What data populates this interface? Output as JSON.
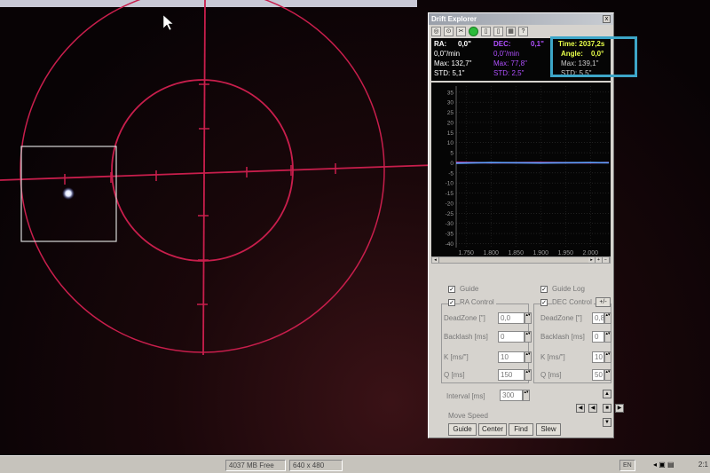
{
  "background_window": {
    "title": ""
  },
  "drift_explorer": {
    "title": "Drift Explorer",
    "close": "x",
    "toolbar_icons": [
      "target-icon",
      "target2-icon",
      "tools-icon",
      "record-icon",
      "page-icon",
      "page2-icon",
      "map-icon",
      "help-icon"
    ],
    "stats": {
      "ra_label": "RA:",
      "ra_value": "0,0\"",
      "ra_rate": "0,0\"/min",
      "ra_max": "Max: 132,7\"",
      "ra_std": "STD: 5,1\"",
      "dec_label": "DEC:",
      "dec_value": "0,1\"",
      "dec_rate": "0,0\"/min",
      "dec_max": "Max: 77,8\"",
      "dec_std": "STD: 2,5\"",
      "time": "Time: 2037,2s",
      "angle_label": "Angle:",
      "angle_value": "0,0°",
      "angle_max": "Max: 139,1\"",
      "angle_std": "STD: 5,5\""
    },
    "controls": {
      "guide": "Guide",
      "guide_log": "Guide Log",
      "ra_control": "RA Control",
      "dec_control": "DEC Control",
      "dec_swap": "+/-",
      "deadzone_label": "DeadZone [\"]",
      "backlash_label": "Backlash [ms]",
      "k_label": "K [ms/\"]",
      "q_label": "Q [ms]",
      "ra_deadzone": "0,0",
      "ra_backlash": "0",
      "ra_k": "10",
      "ra_q": "150",
      "dec_deadzone": "0,8",
      "dec_backlash": "0",
      "dec_k": "10",
      "dec_q": "50",
      "interval_label": "Interval [ms]",
      "interval": "300",
      "move_speed": "Move Speed",
      "buttons": [
        "Guide",
        "Center",
        "Find",
        "Slew"
      ]
    }
  },
  "chart_data": {
    "type": "line",
    "title": "",
    "xlabel": "",
    "ylabel": "",
    "x_ticks": [
      "1.750",
      "1.800",
      "1.850",
      "1.900",
      "1.950",
      "2.000"
    ],
    "y_ticks": [
      35,
      30,
      25,
      20,
      15,
      10,
      5,
      0,
      -5,
      -10,
      -15,
      -20,
      -25,
      -30,
      -35,
      -40
    ],
    "xlim": [
      1730,
      2037
    ],
    "ylim": [
      -42,
      38
    ],
    "grid": true,
    "series": [
      {
        "color": "#e040c0",
        "x": [
          1730,
          1800,
          1900,
          2000,
          2037
        ],
        "y": [
          0.2,
          0.0,
          0.1,
          0.0,
          0.1
        ]
      },
      {
        "color": "#60a0ff",
        "x": [
          1730,
          1800,
          1900,
          2000,
          2037
        ],
        "y": [
          -0.2,
          0.1,
          -0.1,
          0.1,
          0.0
        ]
      }
    ]
  },
  "status_bar": {
    "free_space": "4037 MB Free",
    "resolution": "640 x 480",
    "language": "EN",
    "clock": "2:1"
  },
  "colors": {
    "reticle": "#c81e4c",
    "box": "#d8d8d8",
    "highlight": "#3da6c8",
    "dec": "#b050ff",
    "time": "#e8ff4a"
  }
}
